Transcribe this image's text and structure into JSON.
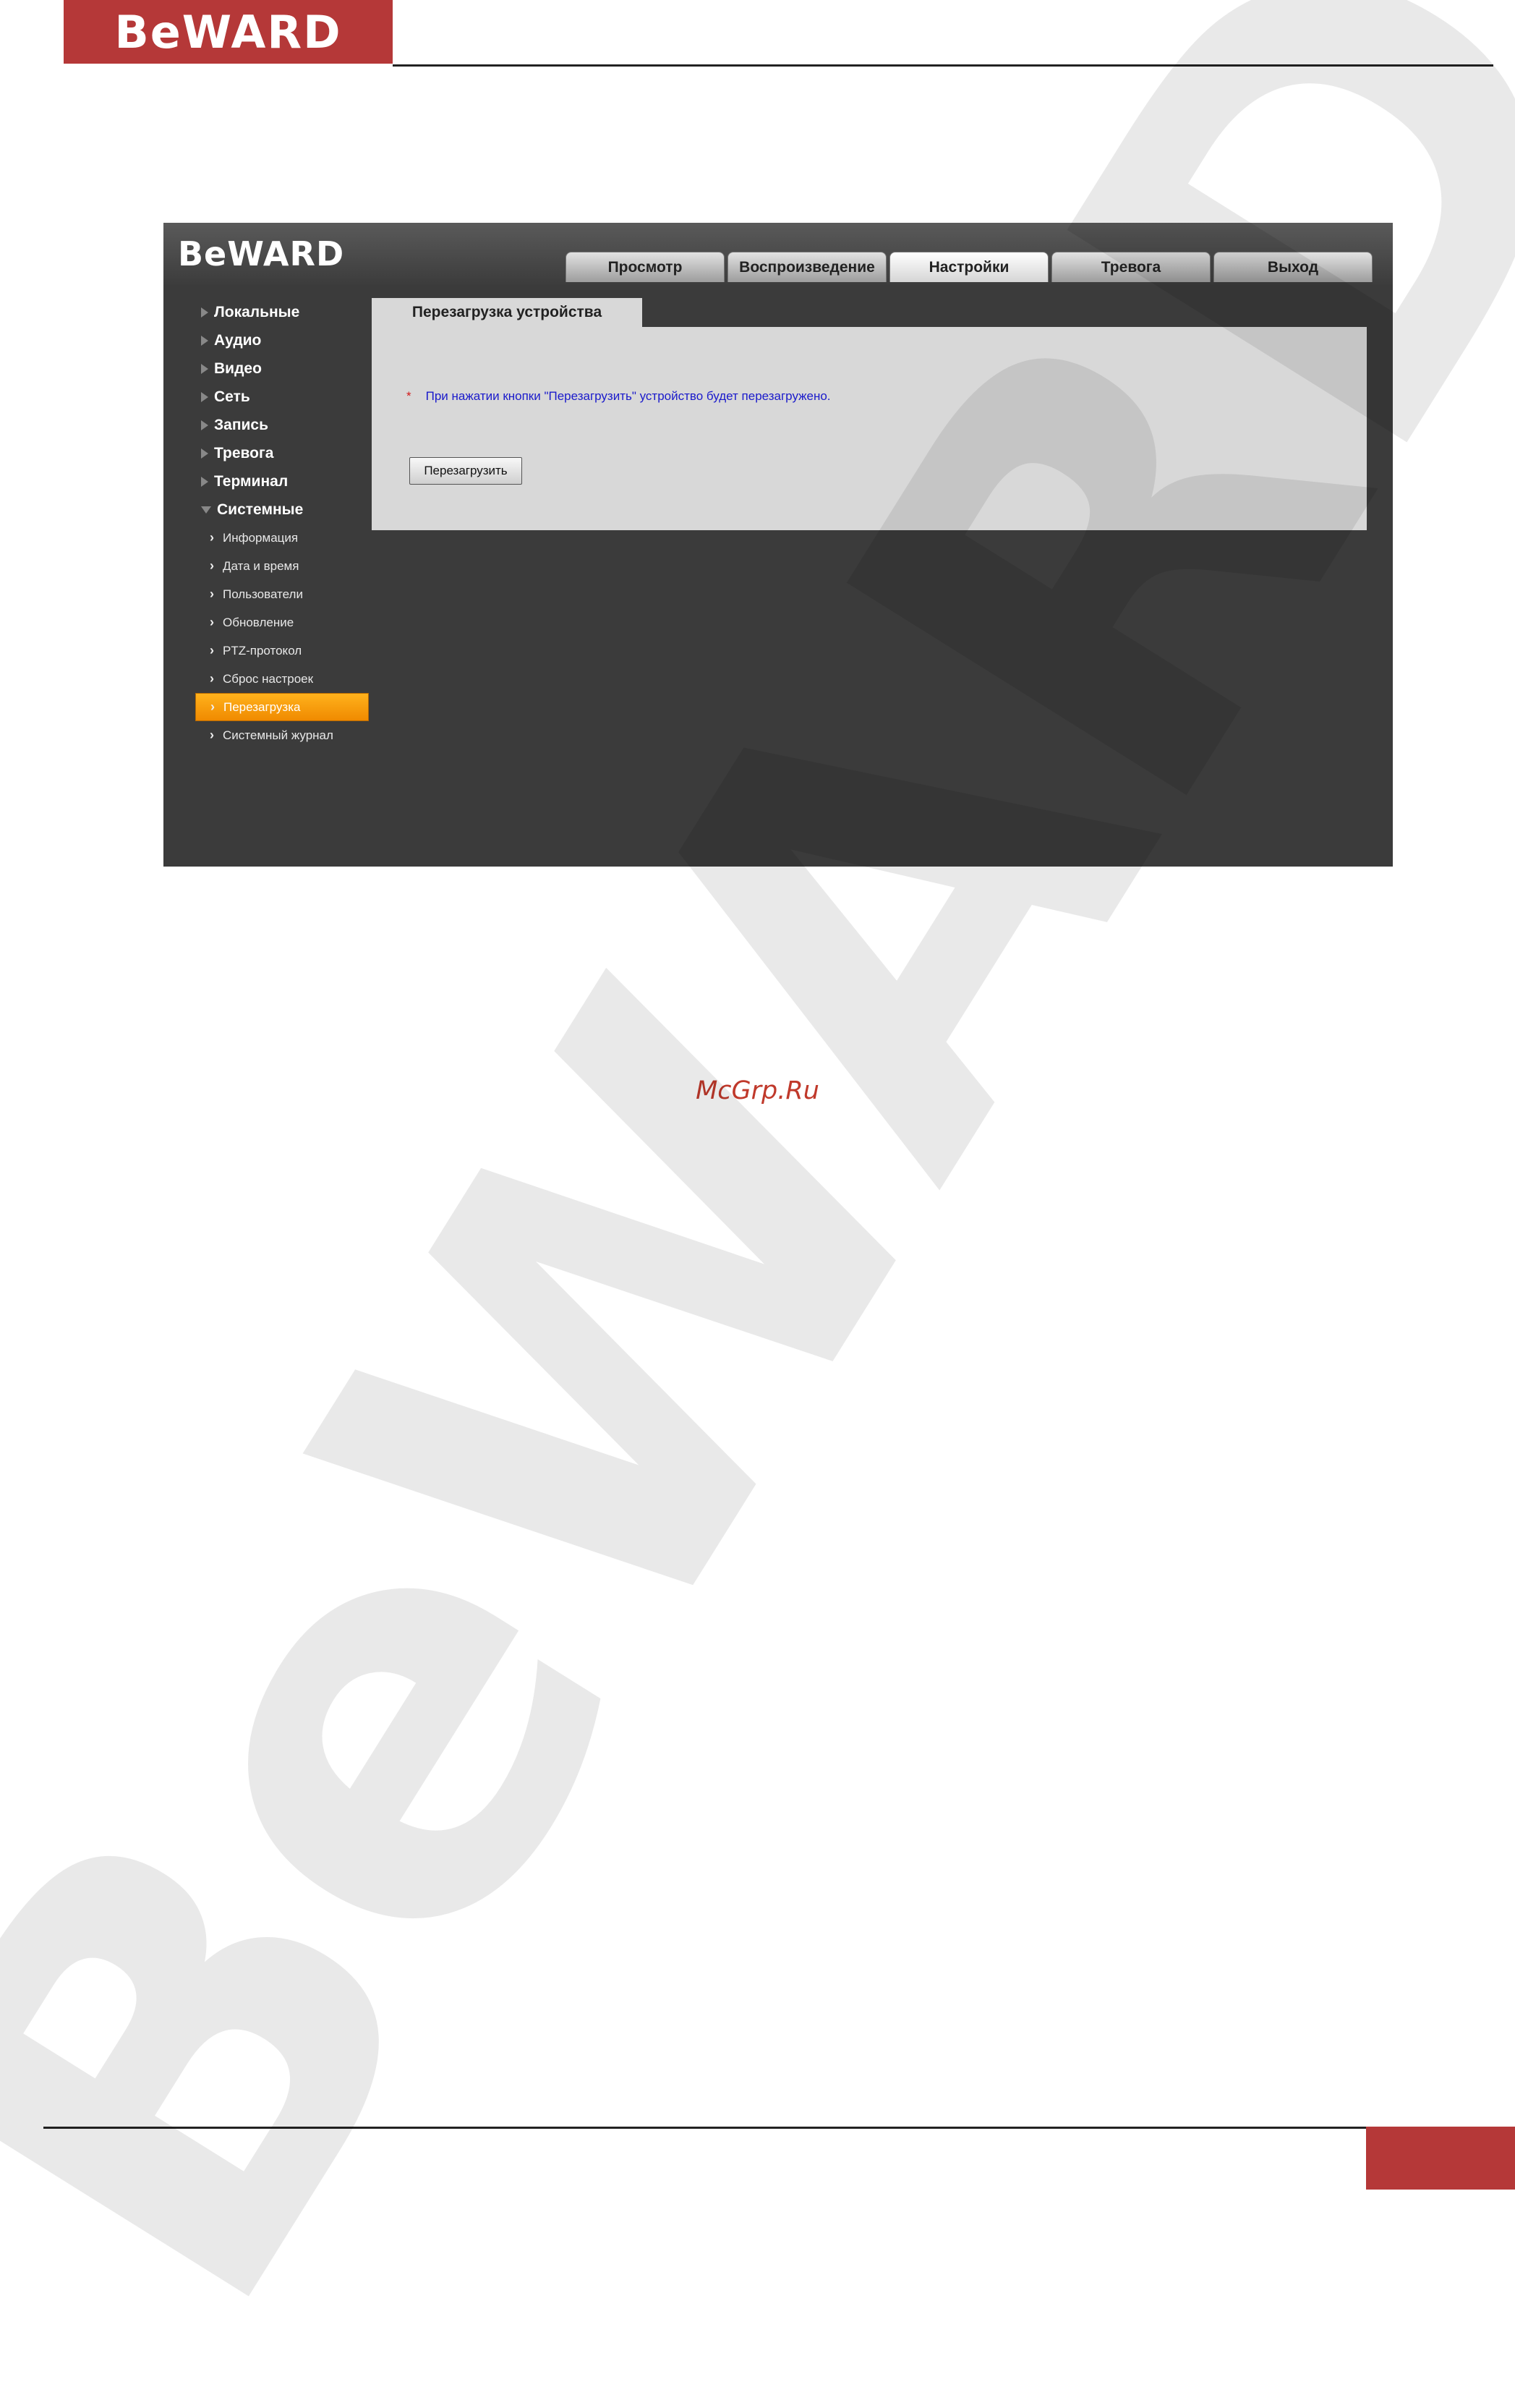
{
  "document": {
    "logo_text": "BeWARD",
    "site_mark": "McGrp.Ru",
    "watermark_text": "BeWARD",
    "page_number": ""
  },
  "app": {
    "logo_text": "BeWARD",
    "tabs": [
      {
        "label": "Просмотр",
        "active": false
      },
      {
        "label": "Воспроизведение",
        "active": false
      },
      {
        "label": "Настройки",
        "active": true
      },
      {
        "label": "Тревога",
        "active": false
      },
      {
        "label": "Выход",
        "active": false
      }
    ],
    "sidebar": {
      "sections": [
        {
          "label": "Локальные"
        },
        {
          "label": "Аудио"
        },
        {
          "label": "Видео"
        },
        {
          "label": "Сеть"
        },
        {
          "label": "Запись"
        },
        {
          "label": "Тревога"
        },
        {
          "label": "Терминал"
        },
        {
          "label": "Системные",
          "open": true
        }
      ],
      "system_items": [
        {
          "label": "Информация"
        },
        {
          "label": "Дата и время"
        },
        {
          "label": "Пользователи"
        },
        {
          "label": "Обновление"
        },
        {
          "label": "PTZ-протокол"
        },
        {
          "label": "Сброс настроек"
        },
        {
          "label": "Перезагрузка",
          "active": true
        },
        {
          "label": "Системный журнал"
        }
      ]
    },
    "content": {
      "tab_title": "Перезагрузка устройства",
      "notice_star": "*",
      "notice": "При нажатии кнопки \"Перезагрузить\" устройство будет перезагружено.",
      "reboot_button": "Перезагрузить"
    }
  }
}
